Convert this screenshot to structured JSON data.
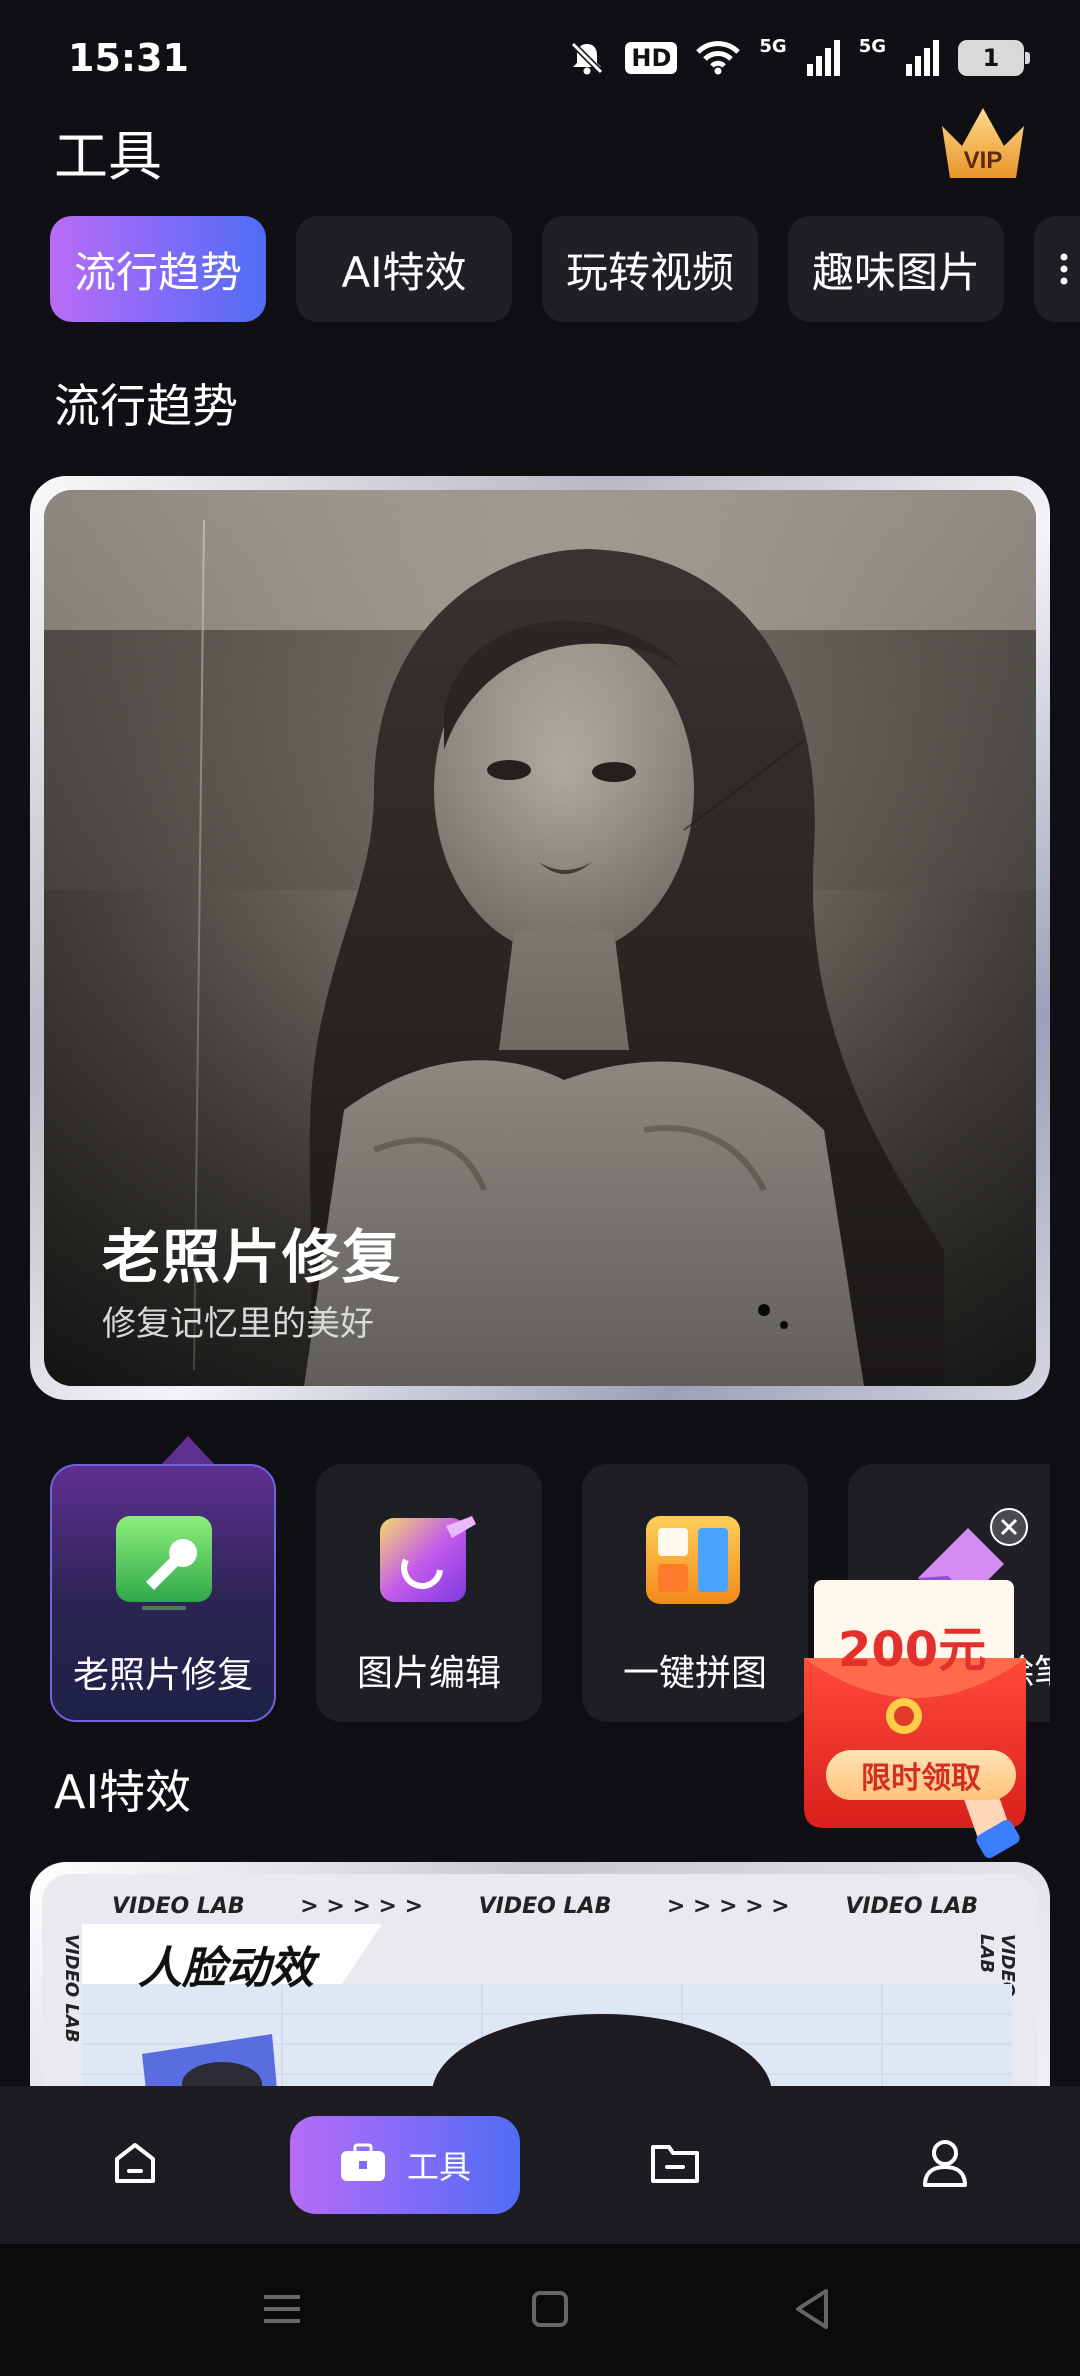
{
  "status_bar": {
    "time": "15:31",
    "hd_label": "HD",
    "net1_label": "5G",
    "net2_label": "5G",
    "battery_level": "1"
  },
  "header": {
    "title": "工具",
    "vip_label": "VIP"
  },
  "tabs": [
    {
      "label": "流行趋势",
      "active": true
    },
    {
      "label": "AI特效",
      "active": false
    },
    {
      "label": "玩转视频",
      "active": false
    },
    {
      "label": "趣味图片",
      "active": false
    }
  ],
  "sections": {
    "trending": "流行趋势",
    "ai_effects": "AI特效"
  },
  "hero": {
    "title": "老照片修复",
    "subtitle": "修复记忆里的美好"
  },
  "tools": [
    {
      "label": "老照片修复",
      "icon": "wrench-icon",
      "active": true
    },
    {
      "label": "图片编辑",
      "icon": "photo-edit-icon",
      "active": false
    },
    {
      "label": "一键拼图",
      "icon": "puzzle-icon",
      "active": false
    },
    {
      "label": "除笔",
      "icon": "eraser-icon",
      "active": false
    }
  ],
  "ai_card": {
    "strip_text": "VIDEO LAB",
    "arrows": "> > > > >",
    "title": "人脸动效"
  },
  "promo": {
    "amount": "200元",
    "claim_label": "限时领取"
  },
  "bottom_nav": {
    "tools_label": "工具"
  },
  "colors": {
    "background": "#0f0f14",
    "accent_start": "#b86cf6",
    "accent_end": "#4f6df4",
    "promo_red": "#e2312d"
  }
}
